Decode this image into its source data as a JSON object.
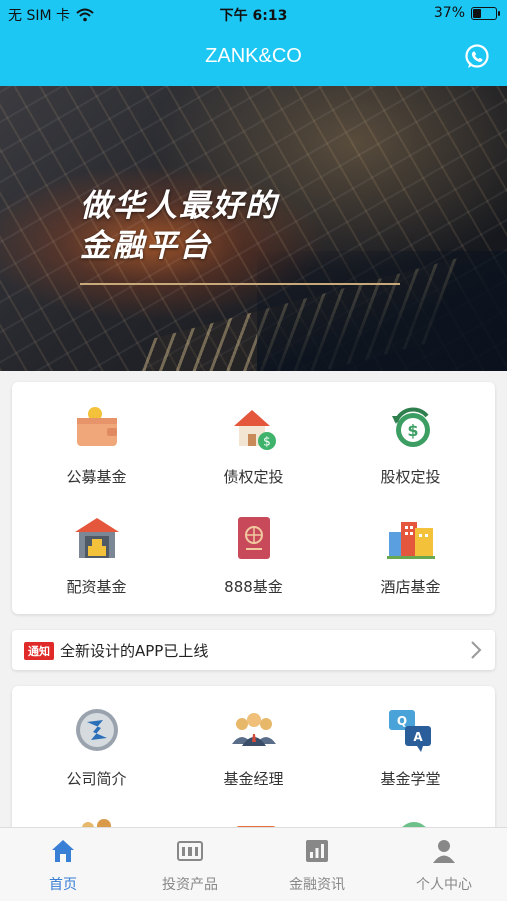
{
  "status_bar": {
    "carrier": "无 SIM 卡",
    "time": "下午 6:13",
    "battery": "37%",
    "battery_level": 0.37
  },
  "nav": {
    "title": "ZANK&CO",
    "right_icon": "whatsapp-icon"
  },
  "banner": {
    "slogan_line1": "做华人最好的",
    "slogan_line2": "金融平台"
  },
  "services": [
    {
      "label": "公募基金",
      "icon": "wallet-icon"
    },
    {
      "label": "债权定投",
      "icon": "house-dollar-icon"
    },
    {
      "label": "股权定投",
      "icon": "refresh-dollar-icon"
    },
    {
      "label": "配资基金",
      "icon": "warehouse-icon"
    },
    {
      "label": "888基金",
      "icon": "passport-icon"
    },
    {
      "label": "酒店基金",
      "icon": "buildings-icon"
    }
  ],
  "notice": {
    "badge": "通知",
    "text": "全新设计的APP已上线"
  },
  "info": [
    {
      "label": "公司简介",
      "icon": "company-logo-icon"
    },
    {
      "label": "基金经理",
      "icon": "team-icon"
    },
    {
      "label": "基金学堂",
      "icon": "qa-icon"
    }
  ],
  "tabs": [
    {
      "label": "首页",
      "icon": "home-icon",
      "active": true
    },
    {
      "label": "投资产品",
      "icon": "products-icon",
      "active": false
    },
    {
      "label": "金融资讯",
      "icon": "chart-icon",
      "active": false
    },
    {
      "label": "个人中心",
      "icon": "user-icon",
      "active": false
    }
  ],
  "colors": {
    "brand": "#1dc7f4",
    "tab_active": "#3a7fd6",
    "notice_badge": "#e02a2a"
  }
}
